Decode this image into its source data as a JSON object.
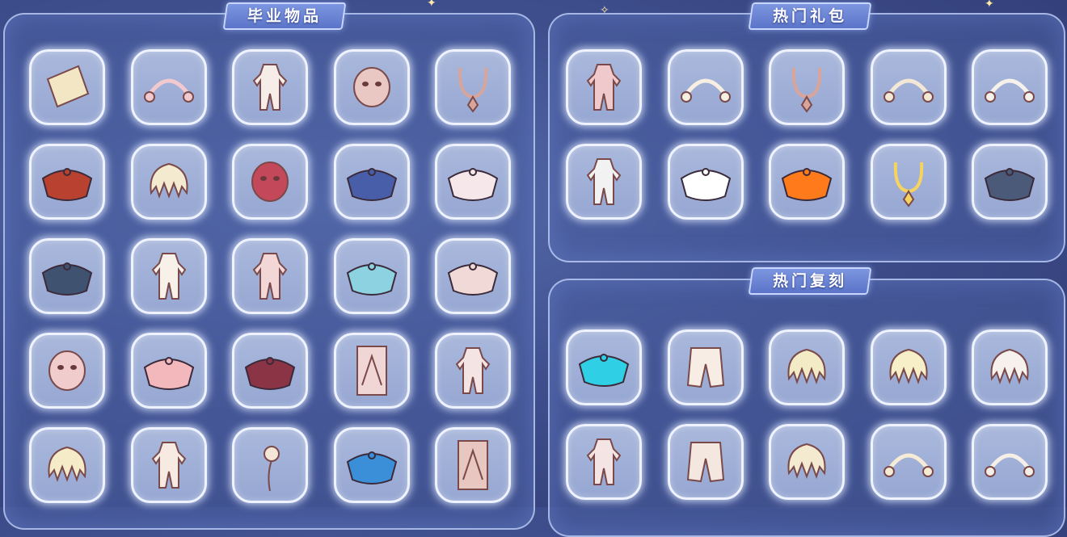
{
  "panels": {
    "graduation": {
      "title": "毕业物品"
    },
    "hot_gifts": {
      "title": "热门礼包"
    },
    "hot_reprints": {
      "title": "热门复刻"
    }
  },
  "graduation_items": [
    {
      "icon": "scroll-bracelet-icon",
      "color": "#f3e6c4"
    },
    {
      "icon": "winged-headband-icon",
      "color": "#f2c9cf"
    },
    {
      "icon": "white-outfit-icon",
      "color": "#f6ece8"
    },
    {
      "icon": "round-mask-icon",
      "color": "#e9c7c2"
    },
    {
      "icon": "pendant-necklace-icon",
      "color": "#d9a59b"
    },
    {
      "icon": "red-cape-icon",
      "color": "#b8412f"
    },
    {
      "icon": "horned-hair-icon",
      "color": "#f4ead0"
    },
    {
      "icon": "antler-mask-icon",
      "color": "#c2485a"
    },
    {
      "icon": "blue-cape-icon",
      "color": "#485ea8"
    },
    {
      "icon": "white-wing-cape-icon",
      "color": "#f6e7ea"
    },
    {
      "icon": "dark-layered-cape-icon",
      "color": "#3f5370"
    },
    {
      "icon": "white-hood-icon",
      "color": "#f7f1ea"
    },
    {
      "icon": "wrap-outfit-icon",
      "color": "#f3d7d7"
    },
    {
      "icon": "teal-cape-icon",
      "color": "#8cd2e0"
    },
    {
      "icon": "scarf-cape-icon",
      "color": "#f0d9d6"
    },
    {
      "icon": "crystal-mask-icon",
      "color": "#f1cccc"
    },
    {
      "icon": "pink-frill-cape-icon",
      "color": "#f2b8bc"
    },
    {
      "icon": "maroon-cape-icon",
      "color": "#8a3446"
    },
    {
      "icon": "figure-statue-icon",
      "color": "#f1d6d6"
    },
    {
      "icon": "hooded-outfit-icon",
      "color": "#f4e4e4"
    },
    {
      "icon": "spiky-hair-icon",
      "color": "#f5ebc8"
    },
    {
      "icon": "long-robe-icon",
      "color": "#f6eae2"
    },
    {
      "icon": "rose-icon",
      "color": "#f4e7d8"
    },
    {
      "icon": "blue-feather-cape-icon",
      "color": "#3b8fd8"
    },
    {
      "icon": "framed-portrait-icon",
      "color": "#e8c7c0"
    }
  ],
  "gift_items": [
    {
      "icon": "pink-outfit-icon",
      "color": "#efc9cb"
    },
    {
      "icon": "moon-star-crown-icon",
      "color": "#f6efe2"
    },
    {
      "icon": "diamond-necklace-icon",
      "color": "#d9a59b"
    },
    {
      "icon": "antler-horns-icon",
      "color": "#f3e8d6"
    },
    {
      "icon": "wizard-hat-icon",
      "color": "#f6f1ea"
    },
    {
      "icon": "cat-outline-outfit-icon",
      "color": "#f2f2f2"
    },
    {
      "icon": "four-petal-cape-icon",
      "color": "#ffffff"
    },
    {
      "icon": "orange-cape-icon",
      "color": "#ff7a1a"
    },
    {
      "icon": "gold-chain-necklace-icon",
      "color": "#f6d35e"
    },
    {
      "icon": "gray-bat-cape-icon",
      "color": "#4a5a78"
    }
  ],
  "reprint_items": [
    {
      "icon": "cyan-swirl-cape-icon",
      "color": "#2fd0e6"
    },
    {
      "icon": "baggy-pants-icon",
      "color": "#f7ede4"
    },
    {
      "icon": "long-wavy-hair-icon",
      "color": "#f3ebc6"
    },
    {
      "icon": "short-tuft-hair-icon",
      "color": "#f7efc8"
    },
    {
      "icon": "cat-ear-hair-icon",
      "color": "#f7f1ee"
    },
    {
      "icon": "jumpsuit-outfit-icon",
      "color": "#f4e4e4"
    },
    {
      "icon": "cargo-pants-icon",
      "color": "#f3e7e0"
    },
    {
      "icon": "flower-crown-hair-icon",
      "color": "#f4ead0"
    },
    {
      "icon": "earmuffs-icon",
      "color": "#f6ecd6"
    },
    {
      "icon": "saucer-hat-icon",
      "color": "#f5efe8"
    }
  ]
}
